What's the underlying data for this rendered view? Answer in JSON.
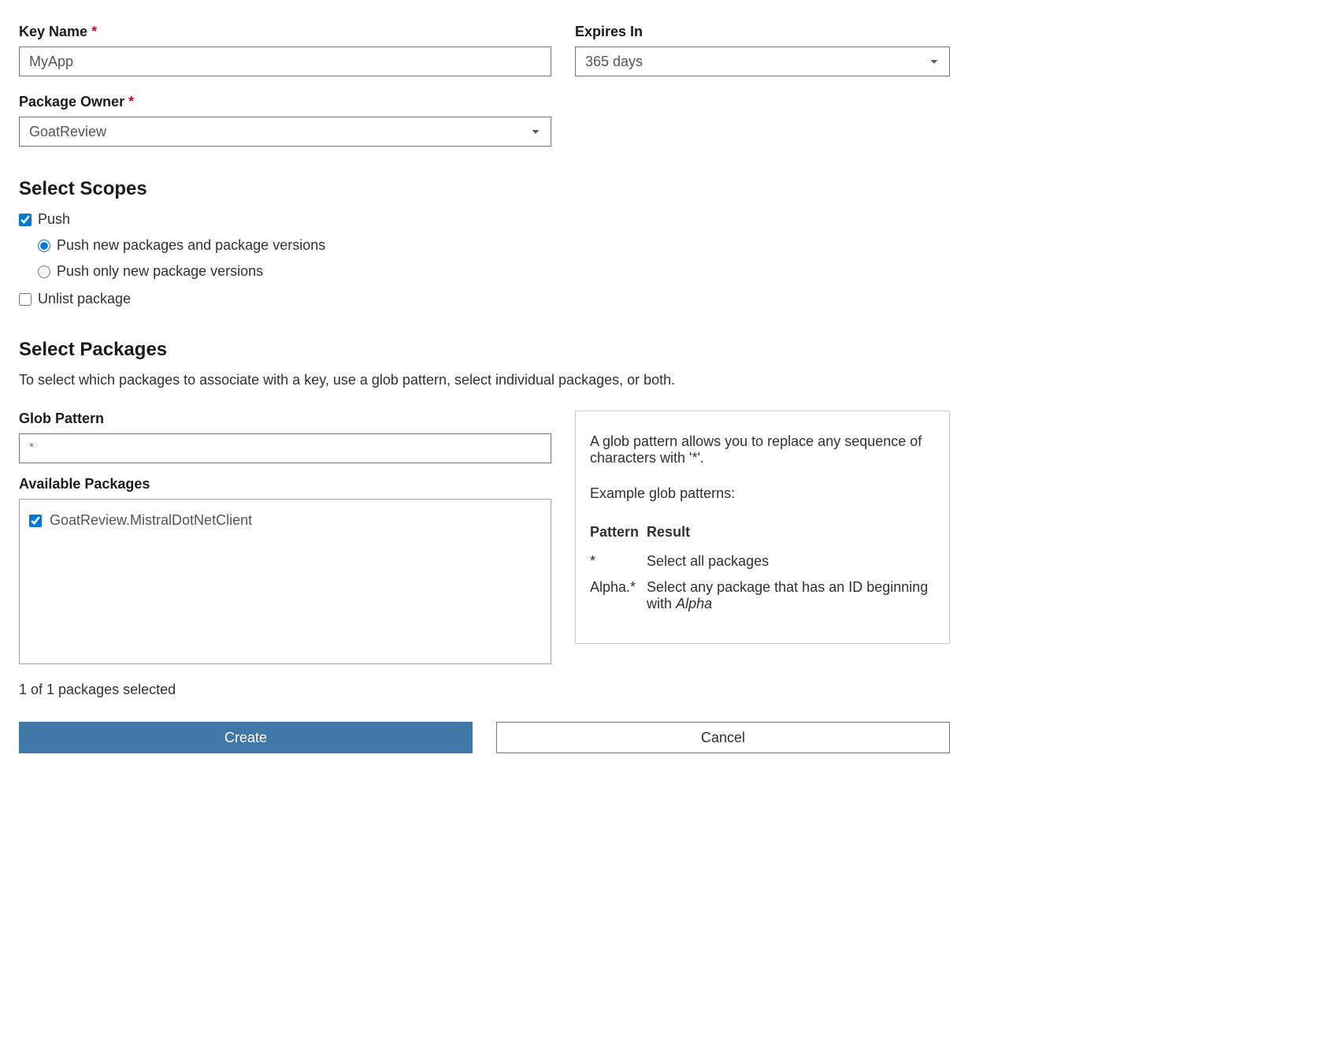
{
  "keyName": {
    "label": "Key Name",
    "value": "MyApp"
  },
  "expires": {
    "label": "Expires In",
    "value": "365 days"
  },
  "owner": {
    "label": "Package Owner",
    "value": "GoatReview"
  },
  "scopes": {
    "heading": "Select Scopes",
    "push": {
      "label": "Push",
      "checked": true
    },
    "pushNew": {
      "label": "Push new packages and package versions",
      "selected": true
    },
    "pushOnly": {
      "label": "Push only new package versions",
      "selected": false
    },
    "unlist": {
      "label": "Unlist package",
      "checked": false
    }
  },
  "packages": {
    "heading": "Select Packages",
    "desc": "To select which packages to associate with a key, use a glob pattern, select individual packages, or both.",
    "glob": {
      "label": "Glob Pattern",
      "placeholder": "*"
    },
    "available": {
      "label": "Available Packages",
      "items": [
        {
          "name": "GoatReview.MistralDotNetClient",
          "checked": true
        }
      ]
    },
    "count": "1 of 1 packages selected"
  },
  "help": {
    "p1": "A glob pattern allows you to replace any sequence of characters with '*'.",
    "p2": "Example glob patterns:",
    "th1": "Pattern",
    "th2": "Result",
    "rows": [
      {
        "pattern": "*",
        "result_pre": "Select all packages",
        "result_em": ""
      },
      {
        "pattern": "Alpha.*",
        "result_pre": "Select any package that has an ID beginning with ",
        "result_em": "Alpha"
      }
    ]
  },
  "buttons": {
    "create": "Create",
    "cancel": "Cancel"
  }
}
